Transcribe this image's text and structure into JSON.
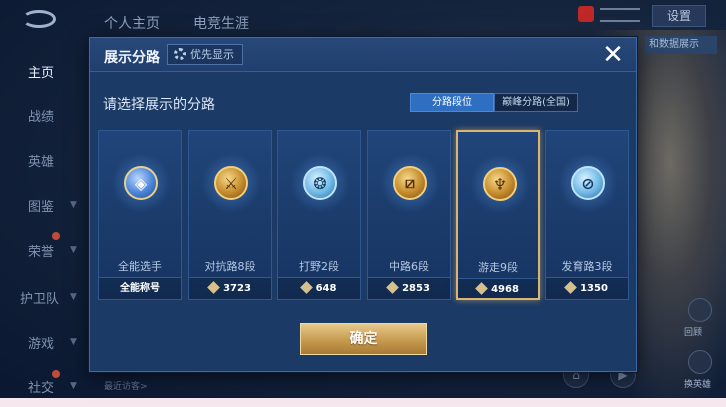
{
  "topbar": {
    "tabs": [
      "个人主页",
      "电竞生涯"
    ],
    "settings_label": "设置",
    "banner_text": "和数据展示"
  },
  "sidebar": {
    "items": [
      {
        "label": "主页",
        "active": true
      },
      {
        "label": "战绩"
      },
      {
        "label": "英雄"
      },
      {
        "label": "图鉴"
      },
      {
        "label": "荣誉"
      },
      {
        "label": "护卫队"
      },
      {
        "label": "游戏"
      },
      {
        "label": "社交"
      }
    ]
  },
  "recent_visitors_label": "最近访客>",
  "right_panel": {
    "top_label": "回顾",
    "bottom_label": "换英雄"
  },
  "dialog": {
    "title": "展示分路",
    "priority_label": "优先显示",
    "close_icon": "close-icon",
    "prompt": "请选择展示的分路",
    "segments": [
      {
        "label": "分路段位",
        "active": true
      },
      {
        "label": "巅峰分路(全国)",
        "active": false
      }
    ],
    "cards": [
      {
        "name": "全能选手",
        "footer": "全能称号",
        "badge_style": "blue",
        "badge_icon": "allround-badge-icon",
        "selected": false,
        "show_diamond": false
      },
      {
        "name": "对抗路8段",
        "footer": "3723",
        "badge_style": "gold",
        "badge_icon": "clash-lane-badge-icon",
        "selected": false,
        "show_diamond": true
      },
      {
        "name": "打野2段",
        "footer": "648",
        "badge_style": "silver",
        "badge_icon": "jungle-badge-icon",
        "selected": false,
        "show_diamond": true
      },
      {
        "name": "中路6段",
        "footer": "2853",
        "badge_style": "gold",
        "badge_icon": "mid-lane-badge-icon",
        "selected": false,
        "show_diamond": true
      },
      {
        "name": "游走9段",
        "footer": "4968",
        "badge_style": "gold",
        "badge_icon": "roam-badge-icon",
        "selected": true,
        "show_diamond": true
      },
      {
        "name": "发育路3段",
        "footer": "1350",
        "badge_style": "silver",
        "badge_icon": "farm-lane-badge-icon",
        "selected": false,
        "show_diamond": true
      }
    ],
    "confirm_label": "确定"
  },
  "colors": {
    "accent_gold": "#d9b56d",
    "segment_active": "#2f6fc2",
    "dialog_bg": "#1c3a66"
  }
}
